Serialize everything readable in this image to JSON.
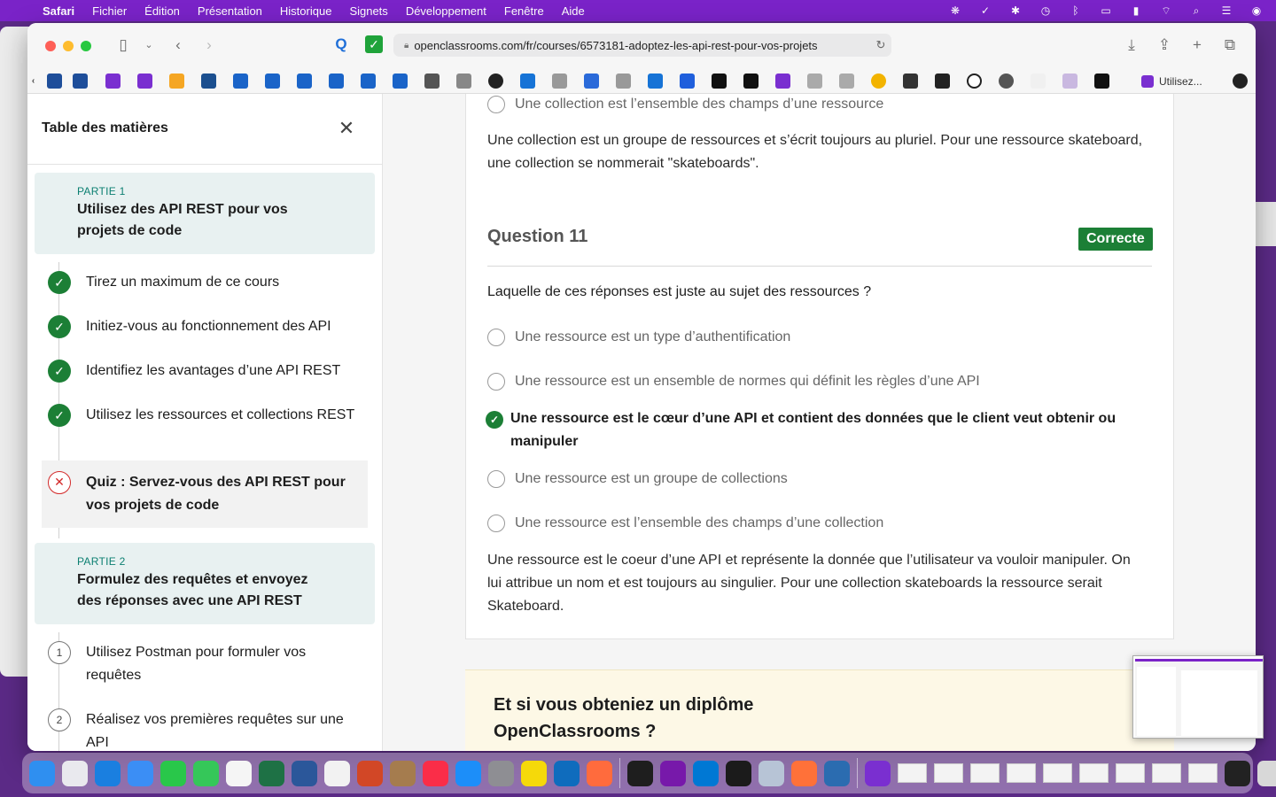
{
  "menubar": {
    "app_name": "Safari",
    "items": [
      "Fichier",
      "Édition",
      "Présentation",
      "Historique",
      "Signets",
      "Développement",
      "Fenêtre",
      "Aide"
    ]
  },
  "browser": {
    "url": "openclassrooms.com/fr/courses/6573181-adoptez-les-api-rest-pour-vos-projets",
    "active_tab_label": "Utilisez..."
  },
  "sidebar": {
    "title": "Table des matières",
    "part1": {
      "label": "PARTIE 1",
      "title": "Utilisez des API REST pour vos projets de code"
    },
    "part1_items": [
      {
        "label": "Tirez un maximum de ce cours",
        "status": "done"
      },
      {
        "label": "Initiez-vous au fonctionnement des API",
        "status": "done"
      },
      {
        "label": "Identifiez les avantages d’une API REST",
        "status": "done"
      },
      {
        "label": "Utilisez les ressources et collections REST",
        "status": "done"
      },
      {
        "label": "Quiz : Servez-vous des API REST pour vos projets de code",
        "status": "failed"
      }
    ],
    "part2": {
      "label": "PARTIE 2",
      "title": "Formulez des requêtes et envoyez des réponses avec une API REST"
    },
    "part2_items": [
      {
        "number": "1",
        "label": "Utilisez Postman pour formuler vos requêtes"
      },
      {
        "number": "2",
        "label": "Réalisez vos premières requêtes sur une API"
      }
    ]
  },
  "main": {
    "prev_question": {
      "last_option": "Une collection est l’ensemble des champs d’une ressource",
      "explanation": "Une collection est un groupe de ressources et s’écrit toujours au pluriel. Pour une ressource skateboard, une collection se nommerait \"skateboards\"."
    },
    "question": {
      "title": "Question 11",
      "status": "Correcte",
      "text": "Laquelle de ces réponses est juste au sujet des ressources ?",
      "options": [
        "Une ressource est un type d’authentification",
        "Une ressource est un ensemble de normes qui définit les règles d’une API",
        "Une ressource est le cœur d’une API et contient des données que le client veut obtenir ou manipuler",
        "Une ressource est un groupe de collections",
        "Une ressource est l’ensemble des champs d’une collection"
      ],
      "correct_index": 2,
      "explanation": "Une ressource est le coeur d’une API et représente la donnée que l’utilisateur va vouloir manipuler. On lui attribue un nom et est toujours au singulier. Pour une collection skateboards la ressource serait Skateboard."
    },
    "promo": {
      "title": "Et si vous obteniez un diplôme OpenClassrooms ?"
    }
  },
  "colors": {
    "accent_green": "#1c7f36",
    "part_label_teal": "#0b7f71",
    "fail_red": "#d32a2a",
    "menubar_purple": "#7a23c8"
  }
}
